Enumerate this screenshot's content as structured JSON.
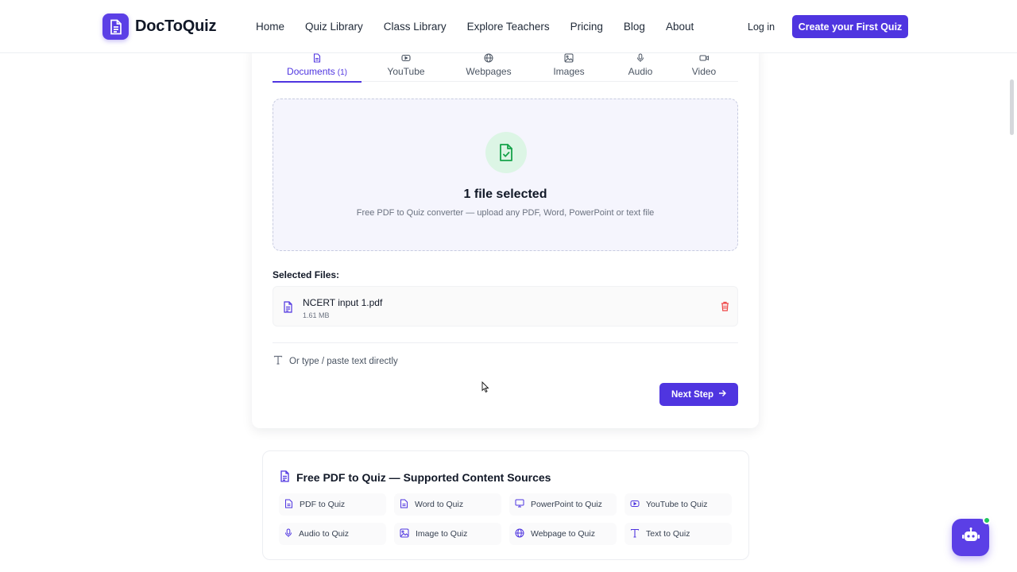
{
  "brand": {
    "name": "DocToQuiz",
    "accent": "#4f35e0"
  },
  "nav": {
    "items": [
      "Home",
      "Quiz Library",
      "Class Library",
      "Explore Teachers",
      "Pricing",
      "Blog",
      "About"
    ]
  },
  "header": {
    "login": "Log in",
    "cta": "Create your First Quiz"
  },
  "tabs": [
    {
      "label": "Documents",
      "count": "(1)",
      "icon": "document-icon",
      "active": true
    },
    {
      "label": "YouTube",
      "icon": "youtube-icon"
    },
    {
      "label": "Webpages",
      "icon": "globe-icon"
    },
    {
      "label": "Images",
      "icon": "image-icon"
    },
    {
      "label": "Audio",
      "icon": "mic-icon"
    },
    {
      "label": "Video",
      "icon": "video-icon"
    }
  ],
  "dropzone": {
    "title": "1 file selected",
    "subtitle": "Free PDF to Quiz converter — upload any PDF, Word, PowerPoint or text file"
  },
  "files": {
    "label": "Selected Files:",
    "items": [
      {
        "name": "NCERT input 1.pdf",
        "size": "1.61 MB"
      }
    ]
  },
  "paste": {
    "label": "Or type / paste text directly"
  },
  "next": {
    "label": "Next Step"
  },
  "sources": {
    "title": "Free PDF to Quiz — Supported Content Sources",
    "items": [
      {
        "label": "PDF to Quiz",
        "icon": "pdf-icon"
      },
      {
        "label": "Word to Quiz",
        "icon": "word-icon"
      },
      {
        "label": "PowerPoint to Quiz",
        "icon": "presentation-icon"
      },
      {
        "label": "YouTube to Quiz",
        "icon": "youtube-icon"
      },
      {
        "label": "Audio to Quiz",
        "icon": "mic-icon"
      },
      {
        "label": "Image to Quiz",
        "icon": "image-icon"
      },
      {
        "label": "Webpage to Quiz",
        "icon": "globe-icon"
      },
      {
        "label": "Text to Quiz",
        "icon": "text-icon"
      }
    ]
  }
}
